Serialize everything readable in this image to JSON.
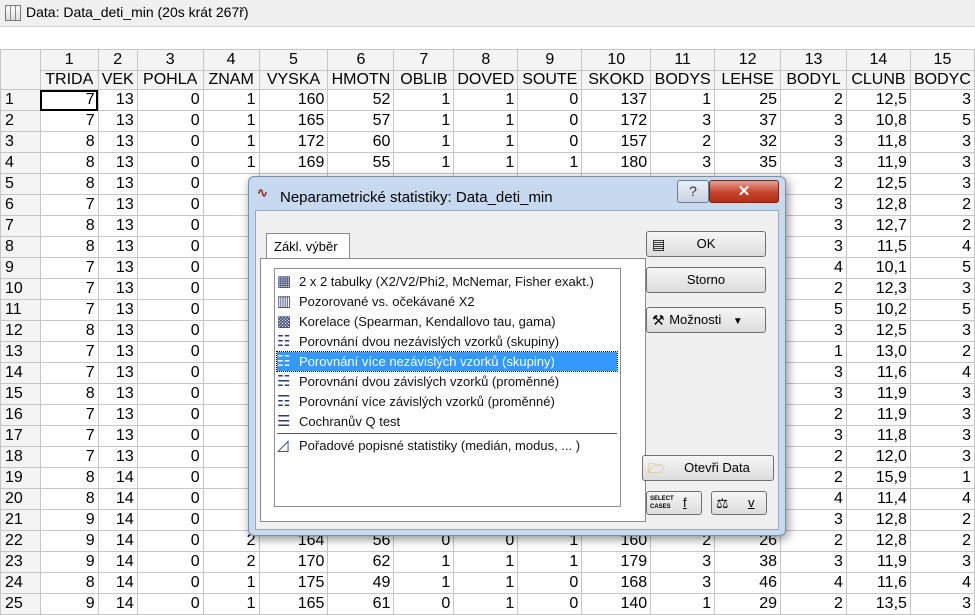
{
  "window": {
    "title": "Data: Data_deti_min (20s krát 267ř)"
  },
  "grid": {
    "col_numbers": [
      "1",
      "2",
      "3",
      "4",
      "5",
      "6",
      "7",
      "8",
      "9",
      "10",
      "11",
      "12",
      "13",
      "14",
      "15"
    ],
    "col_names": [
      "TRIDA",
      "VEK",
      "POHLA",
      "ZNAM",
      "VYSKA",
      "HMOTN",
      "OBLIB",
      "DOVED",
      "SOUTE",
      "SKOKD",
      "BODYS",
      "LEHSE",
      "BODYL",
      "CLUNB",
      "BODYC"
    ],
    "rows": [
      {
        "n": "1",
        "c": [
          "7",
          "13",
          "0",
          "1",
          "160",
          "52",
          "1",
          "1",
          "0",
          "137",
          "1",
          "25",
          "2",
          "12,5",
          "3"
        ]
      },
      {
        "n": "2",
        "c": [
          "7",
          "13",
          "0",
          "1",
          "165",
          "57",
          "1",
          "1",
          "0",
          "172",
          "3",
          "37",
          "3",
          "10,8",
          "5"
        ]
      },
      {
        "n": "3",
        "c": [
          "8",
          "13",
          "0",
          "1",
          "172",
          "60",
          "1",
          "1",
          "0",
          "157",
          "2",
          "32",
          "3",
          "11,8",
          "3"
        ]
      },
      {
        "n": "4",
        "c": [
          "8",
          "13",
          "0",
          "1",
          "169",
          "55",
          "1",
          "1",
          "1",
          "180",
          "3",
          "35",
          "3",
          "11,9",
          "3"
        ]
      },
      {
        "n": "5",
        "c": [
          "8",
          "13",
          "0",
          "",
          "",
          "",
          "",
          "",
          "",
          "",
          "",
          "",
          "2",
          "12,5",
          "3"
        ]
      },
      {
        "n": "6",
        "c": [
          "7",
          "13",
          "0",
          "",
          "",
          "",
          "",
          "",
          "",
          "",
          "",
          "",
          "3",
          "12,8",
          "2"
        ]
      },
      {
        "n": "7",
        "c": [
          "8",
          "13",
          "0",
          "",
          "",
          "",
          "",
          "",
          "",
          "",
          "",
          "",
          "3",
          "12,7",
          "2"
        ]
      },
      {
        "n": "8",
        "c": [
          "8",
          "13",
          "0",
          "",
          "",
          "",
          "",
          "",
          "",
          "",
          "",
          "",
          "3",
          "11,5",
          "4"
        ]
      },
      {
        "n": "9",
        "c": [
          "7",
          "13",
          "0",
          "",
          "",
          "",
          "",
          "",
          "",
          "",
          "",
          "",
          "4",
          "10,1",
          "5"
        ]
      },
      {
        "n": "10",
        "c": [
          "7",
          "13",
          "0",
          "",
          "",
          "",
          "",
          "",
          "",
          "",
          "",
          "",
          "2",
          "12,3",
          "3"
        ]
      },
      {
        "n": "11",
        "c": [
          "7",
          "13",
          "0",
          "",
          "",
          "",
          "",
          "",
          "",
          "",
          "",
          "",
          "5",
          "10,2",
          "5"
        ]
      },
      {
        "n": "12",
        "c": [
          "8",
          "13",
          "0",
          "",
          "",
          "",
          "",
          "",
          "",
          "",
          "",
          "",
          "3",
          "12,5",
          "3"
        ]
      },
      {
        "n": "13",
        "c": [
          "7",
          "13",
          "0",
          "",
          "",
          "",
          "",
          "",
          "",
          "",
          "",
          "",
          "1",
          "13,0",
          "2"
        ]
      },
      {
        "n": "14",
        "c": [
          "7",
          "13",
          "0",
          "",
          "",
          "",
          "",
          "",
          "",
          "",
          "",
          "",
          "3",
          "11,6",
          "4"
        ]
      },
      {
        "n": "15",
        "c": [
          "8",
          "13",
          "0",
          "",
          "",
          "",
          "",
          "",
          "",
          "",
          "",
          "",
          "3",
          "11,9",
          "3"
        ]
      },
      {
        "n": "16",
        "c": [
          "7",
          "13",
          "0",
          "",
          "",
          "",
          "",
          "",
          "",
          "",
          "",
          "",
          "2",
          "11,9",
          "3"
        ]
      },
      {
        "n": "17",
        "c": [
          "7",
          "13",
          "0",
          "",
          "",
          "",
          "",
          "",
          "",
          "",
          "",
          "",
          "3",
          "11,8",
          "3"
        ]
      },
      {
        "n": "18",
        "c": [
          "7",
          "13",
          "0",
          "",
          "",
          "",
          "",
          "",
          "",
          "",
          "",
          "",
          "2",
          "12,0",
          "3"
        ]
      },
      {
        "n": "19",
        "c": [
          "8",
          "14",
          "0",
          "",
          "",
          "",
          "",
          "",
          "",
          "",
          "",
          "",
          "2",
          "15,9",
          "1"
        ]
      },
      {
        "n": "20",
        "c": [
          "8",
          "14",
          "0",
          "",
          "",
          "",
          "",
          "",
          "",
          "",
          "",
          "",
          "4",
          "11,4",
          "4"
        ]
      },
      {
        "n": "21",
        "c": [
          "9",
          "14",
          "0",
          "",
          "",
          "",
          "",
          "",
          "",
          "",
          "",
          "",
          "3",
          "12,8",
          "2"
        ]
      },
      {
        "n": "22",
        "c": [
          "9",
          "14",
          "0",
          "2",
          "164",
          "56",
          "0",
          "0",
          "1",
          "160",
          "2",
          "26",
          "2",
          "12,8",
          "2"
        ]
      },
      {
        "n": "23",
        "c": [
          "9",
          "14",
          "0",
          "2",
          "170",
          "62",
          "1",
          "1",
          "1",
          "179",
          "3",
          "38",
          "3",
          "11,9",
          "3"
        ]
      },
      {
        "n": "24",
        "c": [
          "8",
          "14",
          "0",
          "1",
          "175",
          "49",
          "1",
          "1",
          "0",
          "168",
          "3",
          "46",
          "4",
          "11,6",
          "4"
        ]
      },
      {
        "n": "25",
        "c": [
          "9",
          "14",
          "0",
          "1",
          "165",
          "61",
          "0",
          "1",
          "0",
          "140",
          "1",
          "29",
          "2",
          "13,5",
          "3"
        ]
      }
    ]
  },
  "dialog": {
    "title": "Neparametrické statistiky: Data_deti_min",
    "help_label": "?",
    "close_label": "✕",
    "tab_label": "Zákl. výběr",
    "items": [
      {
        "label": "2 x 2 tabulky (X2/V2/Phi2, McNemar, Fisher exakt.)",
        "icon": "table-2x2-icon"
      },
      {
        "label": "Pozorované vs. očekávané X2",
        "icon": "observed-expected-icon"
      },
      {
        "label": "Korelace (Spearman, Kendallovo tau, gama)",
        "icon": "correlation-icon"
      },
      {
        "label": "Porovnání dvou nezávislých vzorků (skupiny)",
        "icon": "two-independent-icon"
      },
      {
        "label": "Porovnání více nezávislých vzorků (skupiny)",
        "icon": "multi-independent-icon"
      },
      {
        "label": "Porovnání dvou závislých vzorků (proměnné)",
        "icon": "two-dependent-icon"
      },
      {
        "label": "Porovnání více závislých vzorků (proměnné)",
        "icon": "multi-dependent-icon"
      },
      {
        "label": "Cochranův Q test",
        "icon": "cochran-icon"
      },
      {
        "label": "Pořadové popisné statistiky (medián, modus, ... )",
        "icon": "ordinal-stats-icon"
      }
    ],
    "selected_index": 4,
    "ok_label": "OK",
    "cancel_label": "Storno",
    "options_label": "Možnosti",
    "open_data_label": "Otevři Data",
    "select_cases_label": "SELECT CASES",
    "f_label": "f",
    "v_label": "v"
  },
  "colors": {
    "selection": "#3399ff",
    "dialog_frame": "#c6d9ee",
    "close_button": "#c9412a"
  }
}
